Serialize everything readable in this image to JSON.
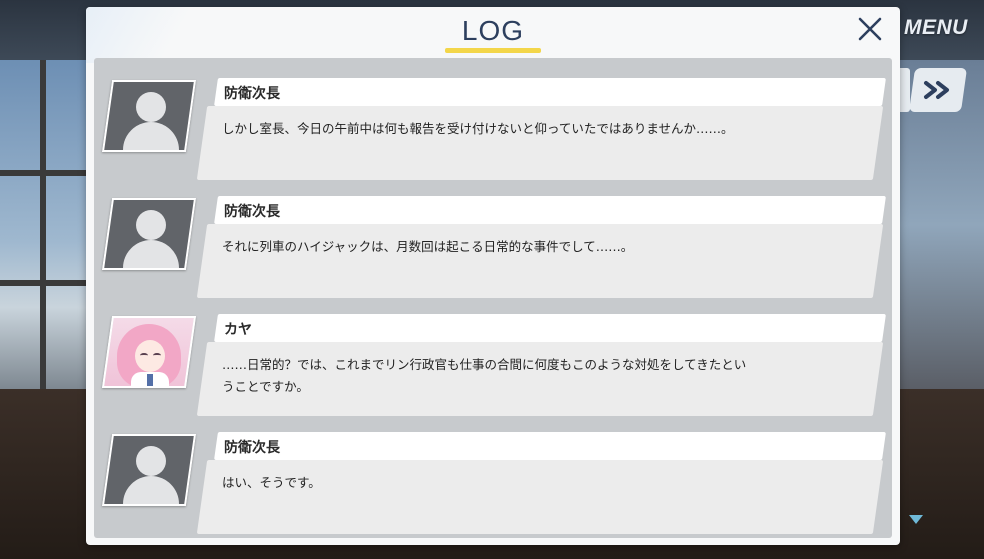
{
  "header": {
    "title": "LOG",
    "menu_label": "MENU"
  },
  "colors": {
    "title": "#2d3f5e",
    "underline": "#f3d64a",
    "panel": "#c7cacd"
  },
  "entries": [
    {
      "speaker": "防衛次長",
      "avatar": "silhouette-avatar",
      "text": "しかし室長、今日の午前中は何も報告を受け付けないと仰っていたではありませんか……。"
    },
    {
      "speaker": "防衛次長",
      "avatar": "silhouette-avatar",
      "text": "それに列車のハイジャックは、月数回は起こる日常的な事件でして……。"
    },
    {
      "speaker": "カヤ",
      "avatar": "kaya-portrait",
      "text_line1": "……日常的？では、これまでリン行政官も仕事の合間に何度もこのような対処をしてきたとい",
      "text_line2": "うことですか。"
    },
    {
      "speaker": "防衛次長",
      "avatar": "silhouette-avatar",
      "text": "はい、そうです。"
    }
  ]
}
